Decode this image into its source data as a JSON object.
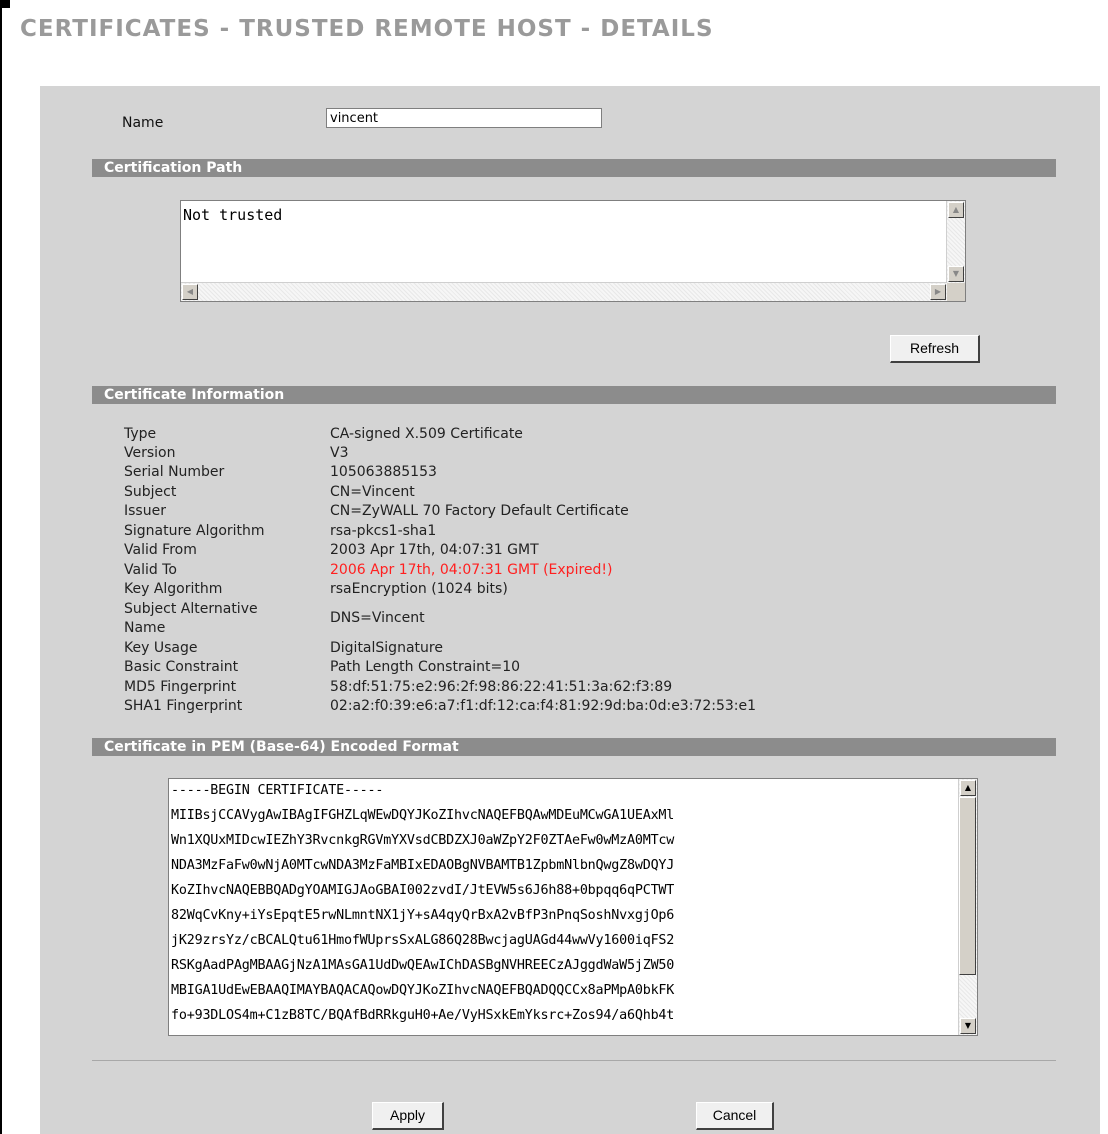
{
  "page_title": "CERTIFICATES - TRUSTED REMOTE HOST - DETAILS",
  "name_field": {
    "label": "Name",
    "value": "vincent"
  },
  "certification_path": {
    "header": "Certification Path",
    "content": "Not trusted"
  },
  "refresh_label": "Refresh",
  "certificate_information": {
    "header": "Certificate Information",
    "rows": [
      {
        "label": "Type",
        "value": "CA-signed X.509 Certificate"
      },
      {
        "label": "Version",
        "value": "V3"
      },
      {
        "label": "Serial Number",
        "value": "105063885153"
      },
      {
        "label": "Subject",
        "value": "CN=Vincent"
      },
      {
        "label": "Issuer",
        "value": "CN=ZyWALL 70 Factory Default Certificate"
      },
      {
        "label": "Signature Algorithm",
        "value": "rsa-pkcs1-sha1"
      },
      {
        "label": "Valid From",
        "value": "2003 Apr 17th, 04:07:31 GMT"
      },
      {
        "label": "Valid To",
        "value": "2006 Apr 17th, 04:07:31 GMT (Expired!)",
        "status": "expired"
      },
      {
        "label": "Key Algorithm",
        "value": "rsaEncryption (1024 bits)"
      },
      {
        "label": "Subject Alternative Name",
        "value": "DNS=Vincent"
      },
      {
        "label": "Key Usage",
        "value": "DigitalSignature"
      },
      {
        "label": "Basic Constraint",
        "value": "Path Length Constraint=10"
      },
      {
        "label": "MD5 Fingerprint",
        "value": "58:df:51:75:e2:96:2f:98:86:22:41:51:3a:62:f3:89"
      },
      {
        "label": "SHA1 Fingerprint",
        "value": "02:a2:f0:39:e6:a7:f1:df:12:ca:f4:81:92:9d:ba:0d:e3:72:53:e1"
      }
    ],
    "subject_alt_line1": "Subject Alternative",
    "subject_alt_line2": "Name"
  },
  "pem": {
    "header": "Certificate in PEM (Base-64) Encoded Format",
    "lines": [
      "-----BEGIN CERTIFICATE-----",
      "MIIBsjCCAVygAwIBAgIFGHZLqWEwDQYJKoZIhvcNAQEFBQAwMDEuMCwGA1UEAxMl",
      "Wn1XQUxMIDcwIEZhY3RvcnkgRGVmYXVsdCBDZXJ0aWZpY2F0ZTAeFw0wMzA0MTcw",
      "NDA3MzFaFw0wNjA0MTcwNDA3MzFaMBIxEDAOBgNVBAMTB1ZpbmNlbnQwgZ8wDQYJ",
      "KoZIhvcNAQEBBQADgYOAMIGJAoGBAI002zvdI/JtEVW5s6J6h88+0bpqq6qPCTWT",
      "82WqCvKny+iYsEpqtE5rwNLmntNX1jY+sA4qyQrBxA2vBfP3nPnqSoshNvxgjOp6",
      "jK29zrsYz/cBCALQtu61HmofWUprsSxALG86Q28BwcjagUAGd44wwVy1600iqFS2",
      "RSKgAadPAgMBAAGjNzA1MAsGA1UdDwQEAwIChDASBgNVHREECzAJggdWaW5jZW50",
      "MBIGA1UdEwEBAAQIMAYBAQACAQowDQYJKoZIhvcNAQEFBQADQQCCx8aPMpA0bkFK",
      "fo+93DLOS4m+C1zB8TC/BQAfBdRRkguH0+Ae/VyHSxkEmYksrc+Zos94/a6Qhb4t"
    ]
  },
  "buttons": {
    "apply": "Apply",
    "cancel": "Cancel"
  },
  "colors": {
    "panel_bg": "#d4d4d4",
    "section_bar": "#8c8c8c",
    "title_gray": "#9a9a9a",
    "expired_red": "#ff2020"
  }
}
